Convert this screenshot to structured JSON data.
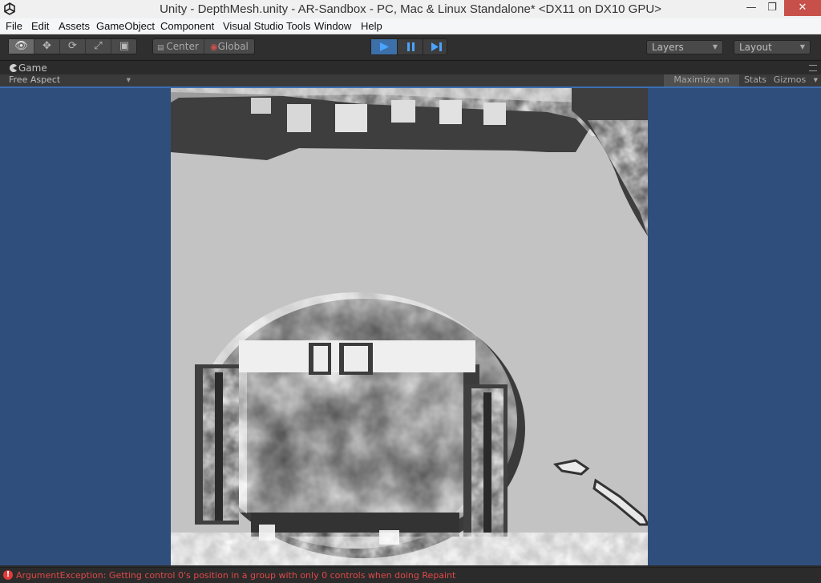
{
  "window": {
    "title": "Unity - DepthMesh.unity - AR-Sandbox - PC, Mac & Linux Standalone* <DX11 on DX10 GPU>",
    "minimize_glyph": "—",
    "maximize_glyph": "❐",
    "close_glyph": "✕",
    "logo_icon": "unity-logo-icon"
  },
  "menu": {
    "items": [
      "File",
      "Edit",
      "Assets",
      "GameObject",
      "Component",
      "Visual Studio Tools",
      "Window",
      "Help"
    ]
  },
  "toolbar": {
    "tools": [
      {
        "name": "view-tool",
        "glyph": "👁",
        "active": true
      },
      {
        "name": "move-tool",
        "glyph": "✥",
        "active": false
      },
      {
        "name": "rotate-tool",
        "glyph": "⟳",
        "active": false
      },
      {
        "name": "scale-tool",
        "glyph": "⤢",
        "active": false
      },
      {
        "name": "rect-tool",
        "glyph": "▣",
        "active": false
      }
    ],
    "pivot": "Center",
    "space": "Global",
    "playback": {
      "play": "▶",
      "pause": "❚❚",
      "step": "▶❚",
      "play_active": true
    },
    "layers_label": "Layers",
    "layout_label": "Layout"
  },
  "game_panel": {
    "tab_label": "Game",
    "aspect_label": "Free Aspect",
    "maximize_label": "Maximize on Play",
    "stats_label": "Stats",
    "gizmos_label": "Gizmos",
    "accent_color": "#3c6fb3",
    "background_color": "#2f4e7c"
  },
  "status": {
    "error_glyph": "!",
    "message": "ArgumentException: Getting control 0's position in a group with only 0 controls when doing Repaint",
    "color": "#e04848"
  }
}
